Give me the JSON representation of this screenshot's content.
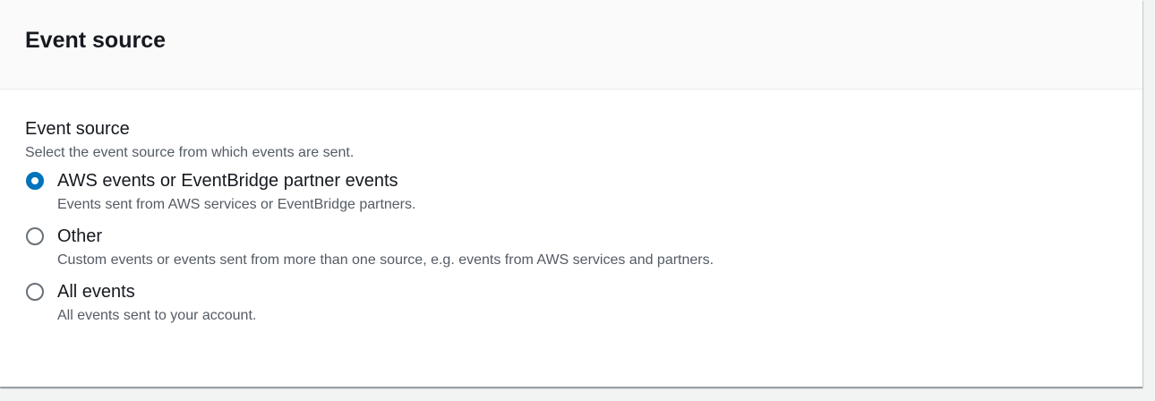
{
  "panel": {
    "title": "Event source"
  },
  "field": {
    "label": "Event source",
    "description": "Select the event source from which events are sent."
  },
  "options": [
    {
      "label": "AWS events or EventBridge partner events",
      "description": "Events sent from AWS services or EventBridge partners.",
      "checked": true
    },
    {
      "label": "Other",
      "description": "Custom events or events sent from more than one source, e.g. events from AWS services and partners.",
      "checked": false
    },
    {
      "label": "All events",
      "description": "All events sent to your account.",
      "checked": false
    }
  ],
  "colors": {
    "accent": "#0073bb",
    "text": "#16191f",
    "secondary": "#545b64"
  }
}
